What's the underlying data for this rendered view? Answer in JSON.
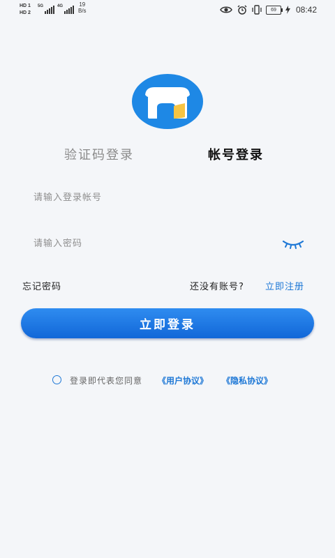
{
  "status_bar": {
    "sim1": "HD 1",
    "sim2": "HD 2",
    "net1": "5G",
    "net2": "4G",
    "speed_value": "19",
    "speed_unit": "B/s",
    "battery": "69",
    "time": "08:42",
    "icons": [
      "eye-icon",
      "alarm-icon",
      "vibrate-icon",
      "battery-icon",
      "charging-icon"
    ]
  },
  "tabs": {
    "sms": "验证码登录",
    "account": "帐号登录",
    "active": "account"
  },
  "form": {
    "account_placeholder": "请输入登录帐号",
    "account_value": "",
    "password_placeholder": "请输入密码",
    "password_value": "",
    "password_toggle_icon": "eye-closed-icon"
  },
  "links": {
    "forgot_password": "忘记密码",
    "no_account": "还没有账号?",
    "register": "立即注册"
  },
  "login_button": "立即登录",
  "agreement": {
    "text": "登录即代表您同意",
    "user_agreement": "《用户协议》",
    "privacy_policy": "《隐私协议》",
    "checked": false
  },
  "colors": {
    "accent": "#1e78d6",
    "button": "#1a73e0",
    "background": "#f4f6f9",
    "logo_circle": "#1e88e5",
    "logo_door": "#f6c443"
  }
}
